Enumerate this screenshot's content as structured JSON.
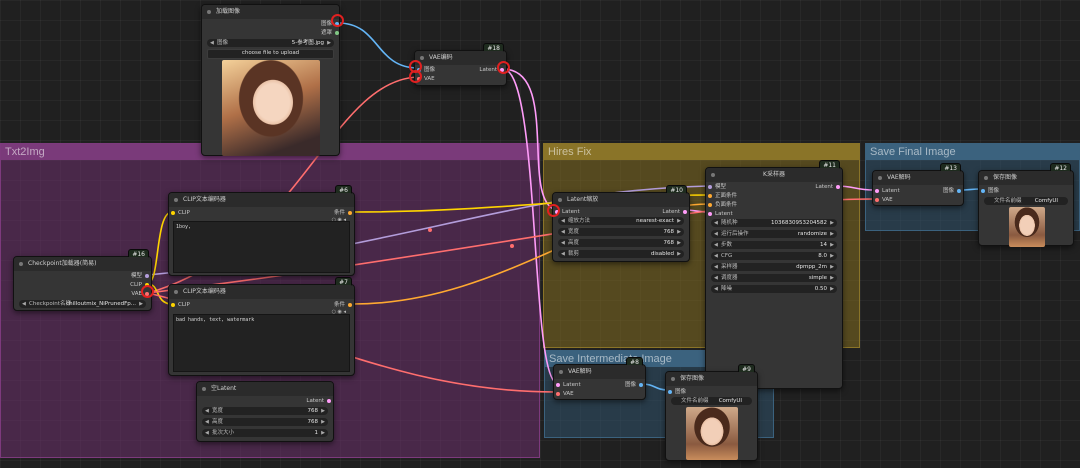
{
  "groups": {
    "txt2img": {
      "title": "Txt2Img",
      "color": "#6c2f6c"
    },
    "hires": {
      "title": "Hires Fix",
      "color": "#7a6520"
    },
    "save_final": {
      "title": "Save Final Image",
      "color": "#2e4f66"
    },
    "save_inter": {
      "title": "Save Intermediate Image",
      "color": "#2e4f66"
    }
  },
  "nodes": {
    "load_image": {
      "title": "加载图像",
      "outputs": [
        "图像",
        "遮罩"
      ],
      "image_widget": {
        "label": "图像",
        "value": "5-参考图.jpg"
      },
      "upload_button": "choose file to upload"
    },
    "vae_encode": {
      "badge": "#18",
      "title": "VAE编码",
      "inputs": [
        "图像",
        "VAE"
      ],
      "output": "Latent"
    },
    "clip_pos": {
      "badge": "#6",
      "title": "CLIP文本编码器",
      "input": "CLIP",
      "output": "条件",
      "text": "1boy,"
    },
    "clip_neg": {
      "badge": "#7",
      "title": "CLIP文本编码器",
      "input": "CLIP",
      "output": "条件",
      "text": "bad hands, text, watermark"
    },
    "checkpoint": {
      "badge": "#16",
      "title": "Checkpoint加载器(简易)",
      "outputs": [
        "模型",
        "CLIP",
        "VAE"
      ],
      "widget": {
        "label": "Checkpoint名称",
        "value": "chilloutmix_NiPrunedFp..."
      }
    },
    "empty_latent": {
      "title": "空Latent",
      "output": "Latent",
      "widgets": [
        {
          "label": "宽度",
          "value": "768"
        },
        {
          "label": "高度",
          "value": "768"
        },
        {
          "label": "批次大小",
          "value": "1"
        }
      ]
    },
    "latent_scale": {
      "badge": "#10",
      "title": "Latent缩放",
      "input": "Latent",
      "output": "Latent",
      "widgets": [
        {
          "label": "缩放方法",
          "value": "nearest-exact"
        },
        {
          "label": "宽度",
          "value": "768"
        },
        {
          "label": "高度",
          "value": "768"
        },
        {
          "label": "裁剪",
          "value": "disabled"
        }
      ]
    },
    "ksampler": {
      "badge": "#11",
      "title": "K采样器",
      "inputs": [
        "模型",
        "正面条件",
        "负面条件",
        "Latent"
      ],
      "output": "Latent",
      "widgets": [
        {
          "label": "随机种",
          "value": "1036830953204582"
        },
        {
          "label": "运行后操作",
          "value": "randomize"
        },
        {
          "label": "步数",
          "value": "14"
        },
        {
          "label": "CFG",
          "value": "8.0"
        },
        {
          "label": "采样器",
          "value": "dpmpp_2m"
        },
        {
          "label": "调度器",
          "value": "simple"
        },
        {
          "label": "降噪",
          "value": "0.50"
        }
      ]
    },
    "vae_decode_final": {
      "badge": "#13",
      "title": "VAE解码",
      "inputs": [
        "Latent",
        "VAE"
      ],
      "output": "图像"
    },
    "save_final": {
      "badge": "#12",
      "title": "保存图像",
      "input": "图像",
      "widget": {
        "label": "文件名前缀",
        "value": "ComfyUI"
      }
    },
    "vae_decode_inter": {
      "badge": "#8",
      "title": "VAE解码",
      "inputs": [
        "Latent",
        "VAE"
      ],
      "output": "图像"
    },
    "save_inter": {
      "badge": "#9",
      "title": "保存图像",
      "input": "图像",
      "widget": {
        "label": "文件名前缀",
        "value": "ComfyUI"
      }
    }
  },
  "colors": {
    "model": "#b39ddb",
    "clip": "#ffd500",
    "vae": "#ff6e6e",
    "latent": "#ff9cf9",
    "image": "#64b5f6",
    "conditioning": "#ffa931",
    "highlight": "#e02020"
  }
}
